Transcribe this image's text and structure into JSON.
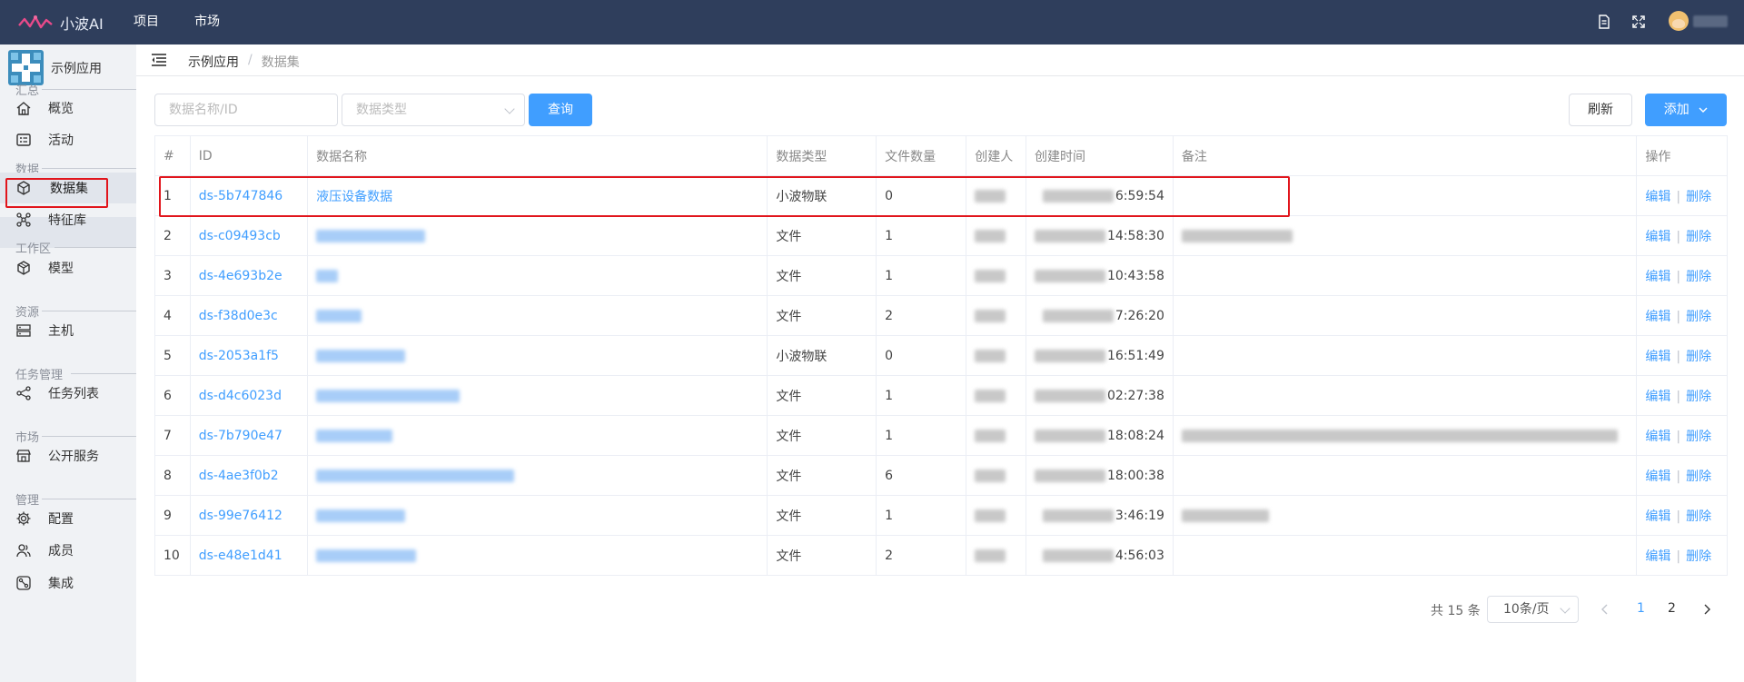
{
  "header": {
    "logo_text": "小波AI",
    "nav": [
      "项目",
      "市场"
    ],
    "icons": [
      "document-icon",
      "fullscreen-icon"
    ],
    "user_name": ""
  },
  "sidebar": {
    "app_name": "示例应用",
    "sections": [
      {
        "title": "汇总",
        "items": [
          {
            "label": "概览",
            "icon": "home-icon"
          },
          {
            "label": "活动",
            "icon": "activity-icon"
          }
        ]
      },
      {
        "title": "数据",
        "items": [
          {
            "label": "数据集",
            "icon": "dataset-cube-icon",
            "active": true
          },
          {
            "label": "特征库",
            "icon": "feature-graph-icon"
          }
        ]
      },
      {
        "title": "工作区",
        "items": [
          {
            "label": "模型",
            "icon": "model-cube-icon"
          }
        ]
      },
      {
        "title": "资源",
        "items": [
          {
            "label": "主机",
            "icon": "server-icon"
          }
        ]
      },
      {
        "title": "任务管理",
        "items": [
          {
            "label": "任务列表",
            "icon": "task-share-icon"
          }
        ]
      },
      {
        "title": "市场",
        "items": [
          {
            "label": "公开服务",
            "icon": "store-icon"
          }
        ]
      },
      {
        "title": "管理",
        "items": [
          {
            "label": "配置",
            "icon": "gear-icon"
          },
          {
            "label": "成员",
            "icon": "members-icon"
          },
          {
            "label": "集成",
            "icon": "integration-icon"
          }
        ]
      }
    ]
  },
  "breadcrumb": {
    "parent": "示例应用",
    "separator": "/",
    "current": "数据集"
  },
  "toolbar": {
    "name_placeholder": "数据名称/ID",
    "type_placeholder": "数据类型",
    "query_label": "查询",
    "refresh_label": "刷新",
    "add_label": "添加"
  },
  "table": {
    "columns": [
      "#",
      "ID",
      "数据名称",
      "数据类型",
      "文件数量",
      "创建人",
      "创建时间",
      "备注",
      "操作"
    ],
    "rows": [
      {
        "index": "1",
        "id": "ds-5b747846",
        "name": "液压设备数据",
        "type": "小波物联",
        "files": "0",
        "time": "6:59:54"
      },
      {
        "index": "2",
        "id": "ds-c09493cb",
        "name": "",
        "type": "文件",
        "files": "1",
        "time": "14:58:30"
      },
      {
        "index": "3",
        "id": "ds-4e693b2e",
        "name": "",
        "type": "文件",
        "files": "1",
        "time": "10:43:58"
      },
      {
        "index": "4",
        "id": "ds-f38d0e3c",
        "name": "",
        "type": "文件",
        "files": "2",
        "time": "7:26:20"
      },
      {
        "index": "5",
        "id": "ds-2053a1f5",
        "name": "",
        "type": "小波物联",
        "files": "0",
        "time": "16:51:49"
      },
      {
        "index": "6",
        "id": "ds-d4c6023d",
        "name": "",
        "type": "文件",
        "files": "1",
        "time": "02:27:38"
      },
      {
        "index": "7",
        "id": "ds-7b790e47",
        "name": "",
        "type": "文件",
        "files": "1",
        "time": "18:08:24"
      },
      {
        "index": "8",
        "id": "ds-4ae3f0b2",
        "name": "",
        "type": "文件",
        "files": "6",
        "time": "18:00:38"
      },
      {
        "index": "9",
        "id": "ds-99e76412",
        "name": "",
        "type": "文件",
        "files": "1",
        "time": "3:46:19"
      },
      {
        "index": "10",
        "id": "ds-e48e1d41",
        "name": "",
        "type": "文件",
        "files": "2",
        "time": "4:56:03"
      }
    ],
    "edit_label": "编辑",
    "op_separator": "|",
    "delete_label": "删除"
  },
  "pagination": {
    "total_text": "共 15 条",
    "page_size": "10条/页",
    "pages": [
      "1",
      "2"
    ],
    "current_page": "1"
  }
}
